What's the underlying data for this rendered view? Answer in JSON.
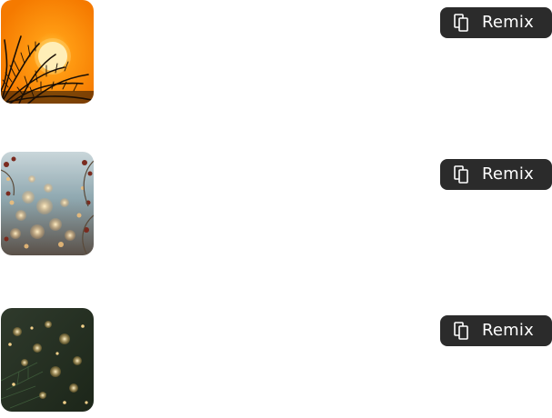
{
  "items": [
    {
      "thumbnail": "sunset-palm-thumbnail",
      "remix_label": "Remix",
      "remix_icon": "copy-layers-icon"
    },
    {
      "thumbnail": "winter-bokeh-thumbnail",
      "remix_label": "Remix",
      "remix_icon": "copy-layers-icon"
    },
    {
      "thumbnail": "pine-lights-thumbnail",
      "remix_label": "Remix",
      "remix_icon": "copy-layers-icon"
    }
  ],
  "colors": {
    "button_background": "#2b2b2b",
    "button_text": "#ffffff",
    "page_background": "#ffffff"
  }
}
